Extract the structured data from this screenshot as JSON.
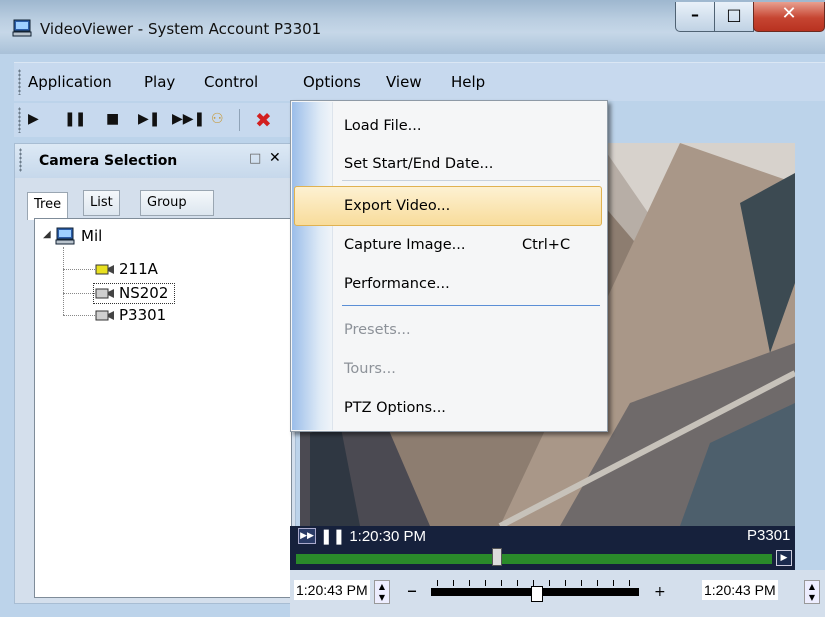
{
  "window": {
    "title": "VideoViewer - System Account P3301"
  },
  "menubar": {
    "items": [
      {
        "label": "Application"
      },
      {
        "label": "Play"
      },
      {
        "label": "Control"
      },
      {
        "label": "Options"
      },
      {
        "label": "View"
      },
      {
        "label": "Help"
      }
    ]
  },
  "toolbar": {
    "icons": [
      "play-icon",
      "pause-icon",
      "stop-icon",
      "step-pause-icon",
      "step-forward-icon",
      "binoculars-icon",
      "delete-icon"
    ],
    "delete_color": "#d21f1f"
  },
  "camera_panel": {
    "title": "Camera Selection",
    "tabs": [
      "Tree",
      "List",
      "Group"
    ],
    "tree": {
      "root": "Mil",
      "cameras": [
        "211A",
        "NS202",
        "P3301"
      ]
    }
  },
  "options_menu": {
    "items": [
      {
        "label": "Load File...",
        "shortcut": "",
        "enabled": true
      },
      {
        "label": "Set Start/End Date...",
        "shortcut": "",
        "enabled": true
      },
      {
        "label": "Export Video...",
        "shortcut": "",
        "enabled": true,
        "highlighted": true
      },
      {
        "label": "Capture Image...",
        "shortcut": "Ctrl+C",
        "enabled": true
      },
      {
        "label": "Performance...",
        "shortcut": "",
        "enabled": true
      },
      {
        "label": "Presets...",
        "shortcut": "",
        "enabled": false
      },
      {
        "label": "Tours...",
        "shortcut": "",
        "enabled": false
      },
      {
        "label": "PTZ Options...",
        "shortcut": "",
        "enabled": true
      }
    ],
    "highlight_color": "#f8dc9b"
  },
  "video": {
    "timestamp": "1:20:30 PM",
    "camera": "P3301",
    "start_time": "1:20:43 PM",
    "end_time": "1:20:43 PM",
    "zoom_minus": "–",
    "zoom_plus": "+"
  }
}
